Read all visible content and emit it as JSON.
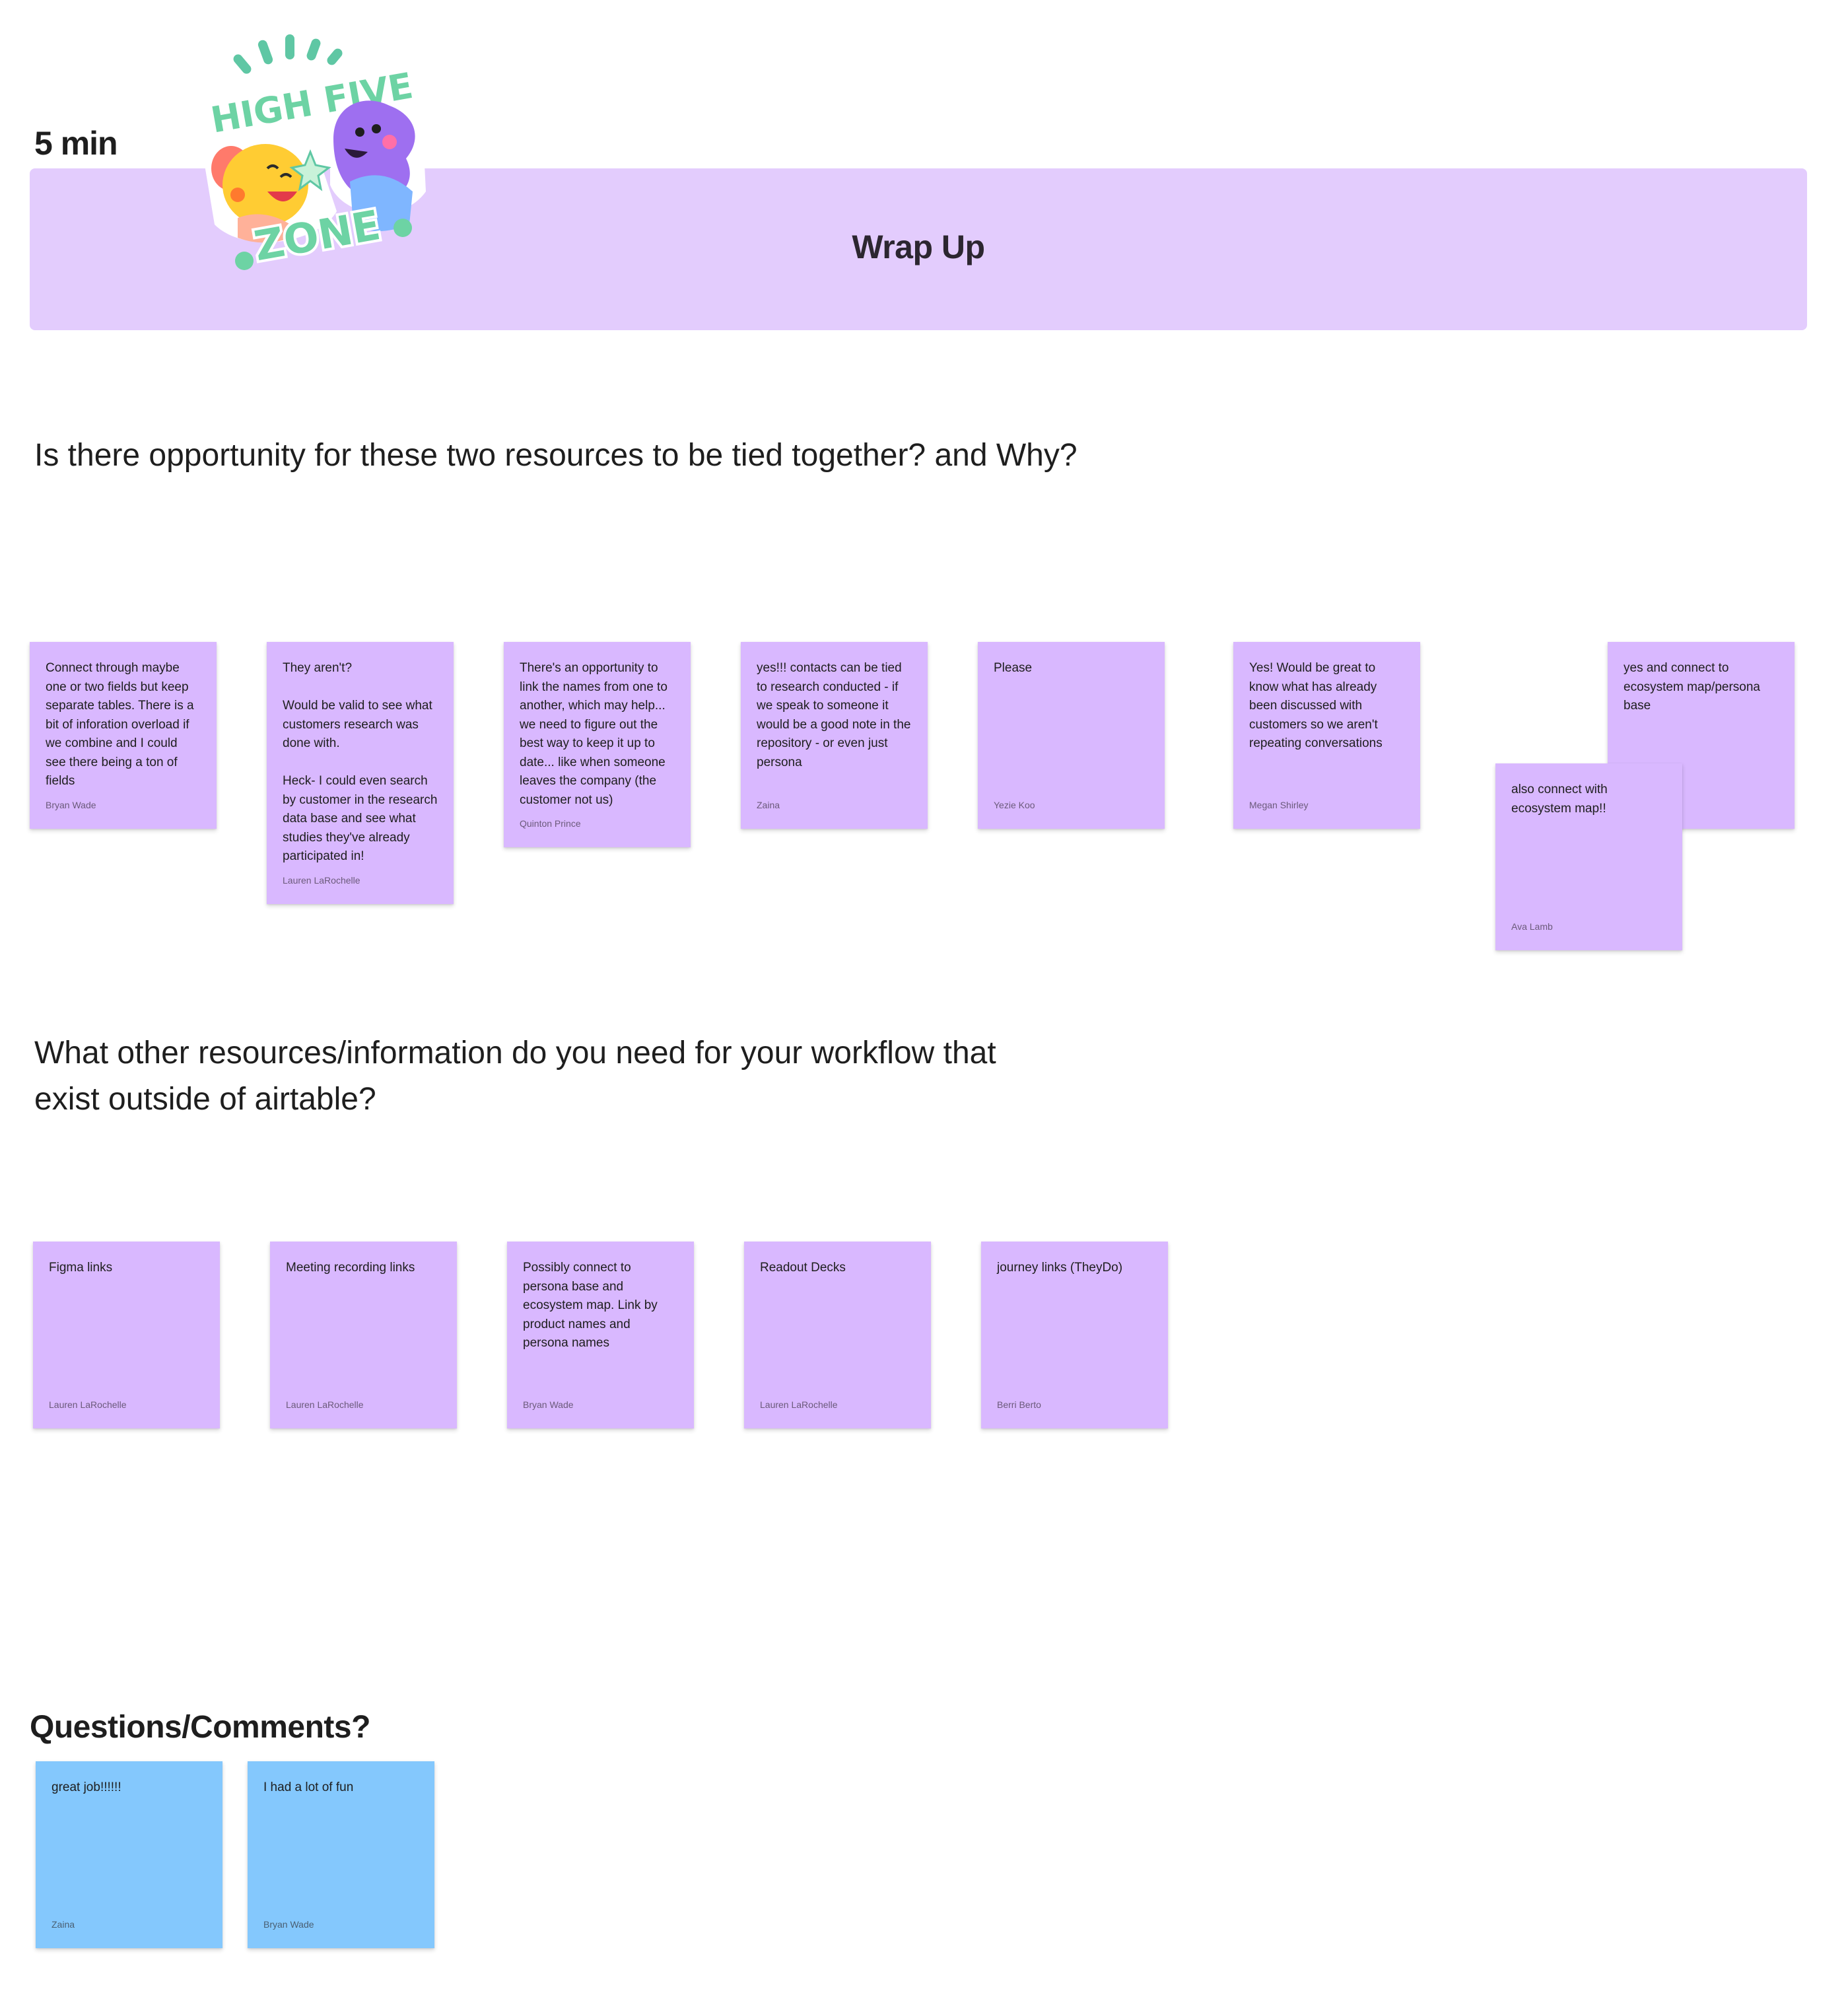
{
  "header": {
    "timer": "5 min",
    "banner_title": "Wrap Up",
    "sticker_top_text": "HIGH FIVE",
    "sticker_bottom_text": "ZONE"
  },
  "section1": {
    "question": "Is there opportunity for these two resources to be tied together? and Why?",
    "notes": [
      {
        "text": "Connect through maybe one or two fields but keep separate tables. There is a bit of inforation overload if we combine and I could see there being a ton of fields",
        "author": "Bryan Wade"
      },
      {
        "text": "They aren't?\n\nWould be valid to see what customers research was done with.\n\nHeck- I could even search by customer in the research data base and see what studies they've already participated in!",
        "author": "Lauren LaRochelle"
      },
      {
        "text": "There's an opportunity to link the names from one to another, which may help... we need to figure out the best way to keep it up to date... like when someone leaves the company (the customer not us)",
        "author": "Quinton Prince"
      },
      {
        "text": "yes!!! contacts can be tied to research conducted - if we speak to someone it would be a good note in the repository - or even just persona",
        "author": "Zaina"
      },
      {
        "text": "Please",
        "author": "Yezie Koo"
      },
      {
        "text": "Yes! Would be great to know what has already been discussed with customers so we aren't repeating conversations",
        "author": "Megan Shirley"
      },
      {
        "text": "yes and connect to ecosystem map/persona base",
        "author": ""
      },
      {
        "text": "also connect with ecosystem map!!",
        "author": "Ava Lamb"
      }
    ]
  },
  "section2": {
    "question": "What other resources/information do you need for your workflow that exist outside of airtable?",
    "notes": [
      {
        "text": "Figma links",
        "author": "Lauren LaRochelle"
      },
      {
        "text": "Meeting recording links",
        "author": "Lauren LaRochelle"
      },
      {
        "text": "Possibly connect to persona base and ecosystem map. Link by product names and persona names",
        "author": "Bryan Wade"
      },
      {
        "text": "Readout Decks",
        "author": "Lauren LaRochelle"
      },
      {
        "text": "journey links (TheyDo)",
        "author": "Berri Berto"
      }
    ]
  },
  "section3": {
    "title": "Questions/Comments?",
    "notes": [
      {
        "text": "great job!!!!!!",
        "author": "Zaina"
      },
      {
        "text": "I had a lot of fun",
        "author": "Bryan Wade"
      }
    ]
  },
  "colors": {
    "banner": "#e3ccfd",
    "purple_note": "#d9b8ff",
    "blue_note": "#84c8fd"
  }
}
